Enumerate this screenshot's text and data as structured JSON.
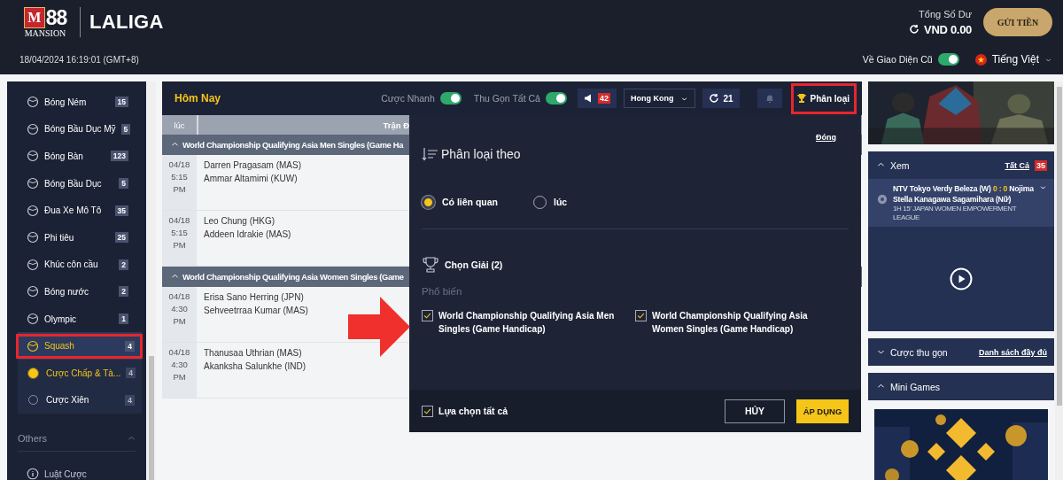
{
  "header": {
    "logo": {
      "letter": "M",
      "number": "88",
      "name": "MANSION"
    },
    "partner": "LALIGA",
    "datetime": "18/04/2024 16:19:01 (GMT+8)",
    "balance_label": "Tổng Số Dư",
    "balance": "VND 0.00",
    "deposit_button": "GỬI TIỀN",
    "classic_view": {
      "label": "Về Giao Diện Cũ",
      "on": true
    },
    "language": "Tiếng Việt"
  },
  "sidebar": {
    "items": [
      {
        "label": "Bóng Ném",
        "count": "15",
        "selected": false
      },
      {
        "label": "Bóng Bầu Dục Mỹ",
        "count": "5",
        "selected": false
      },
      {
        "label": "Bóng Bàn",
        "count": "123",
        "selected": false
      },
      {
        "label": "Bóng Bầu Dục",
        "count": "5",
        "selected": false
      },
      {
        "label": "Đua Xe Mô Tô",
        "count": "35",
        "selected": false
      },
      {
        "label": "Phi tiêu",
        "count": "25",
        "selected": false
      },
      {
        "label": "Khúc côn cầu",
        "count": "2",
        "selected": false
      },
      {
        "label": "Bóng nước",
        "count": "2",
        "selected": false
      },
      {
        "label": "Olympic",
        "count": "1",
        "selected": false
      },
      {
        "label": "Squash",
        "count": "4",
        "selected": true,
        "children": [
          {
            "label": "Cược Chấp & Tà...",
            "count": "4",
            "selected": true
          },
          {
            "label": "Cược Xiên",
            "count": "4",
            "selected": false
          }
        ]
      }
    ],
    "others": {
      "title": "Others",
      "expanded": true,
      "items": [
        "Luật Cược"
      ]
    }
  },
  "main": {
    "title": "Hôm Nay",
    "toggles": [
      {
        "label": "Cược Nhanh",
        "on": true
      },
      {
        "label": "Thu Gọn Tất Cả",
        "on": true
      }
    ],
    "announcements": "42",
    "odds_format": "Hong Kong",
    "refresh": "21",
    "sort_button": "Phân loại",
    "columns": [
      "lúc",
      "Trận Đ"
    ],
    "groups": [
      {
        "title": "World Championship Qualifying Asia Men Singles (Game Ha",
        "expanded": true,
        "matches": [
          {
            "date": "04/18",
            "time": "5:15",
            "period": "PM",
            "home": "Darren Pragasam (MAS)",
            "away": "Ammar Altamimi (KUW)"
          },
          {
            "date": "04/18",
            "time": "5:15",
            "period": "PM",
            "home": "Leo Chung (HKG)",
            "away": "Addeen Idrakie (MAS)"
          }
        ]
      },
      {
        "title": "World Championship Qualifying Asia Women Singles (Game",
        "expanded": true,
        "matches": [
          {
            "date": "04/18",
            "time": "4:30",
            "period": "PM",
            "home": "Erisa Sano Herring (JPN)",
            "away": "Sehveetrraa Kumar (MAS)"
          },
          {
            "date": "04/18",
            "time": "4:30",
            "period": "PM",
            "home": "Thanusaa Uthrian (MAS)",
            "away": "Akanksha Salunkhe (IND)"
          }
        ]
      }
    ]
  },
  "sort_popup": {
    "close": "Đóng",
    "title": "Phân loại theo",
    "options": [
      {
        "label": "Có liên quan",
        "selected": true
      },
      {
        "label": "lúc",
        "selected": false
      }
    ],
    "league_title": "Chọn Giải (2)",
    "group_label": "Phổ biến",
    "leagues": [
      {
        "label": "World Championship Qualifying Asia Men Singles (Game Handicap)",
        "checked": true
      },
      {
        "label": "World Championship Qualifying Asia Women Singles (Game Handicap)",
        "checked": true
      }
    ],
    "select_all": {
      "label": "Lựa chọn tất cả",
      "checked": true
    },
    "cancel": "HỦY",
    "apply": "ÁP DỤNG"
  },
  "right": {
    "watch": {
      "title": "Xem",
      "expanded": true,
      "all_link": "Tất Cả",
      "count": "35",
      "match": {
        "home": "NTV Tokyo Verdy Beleza (W)",
        "score": "0 : 0",
        "away": "Nojima Stella Kanagawa Sagamihara (Nữ)",
        "info": "1H 15' JAPAN WOMEN EMPOWERMENT LEAGUE"
      }
    },
    "quick_bets": {
      "title": "Cược thu gọn",
      "expanded": false,
      "link": "Danh sách đầy đủ"
    },
    "mini_games": {
      "title": "Mini Games",
      "expanded": true
    }
  }
}
